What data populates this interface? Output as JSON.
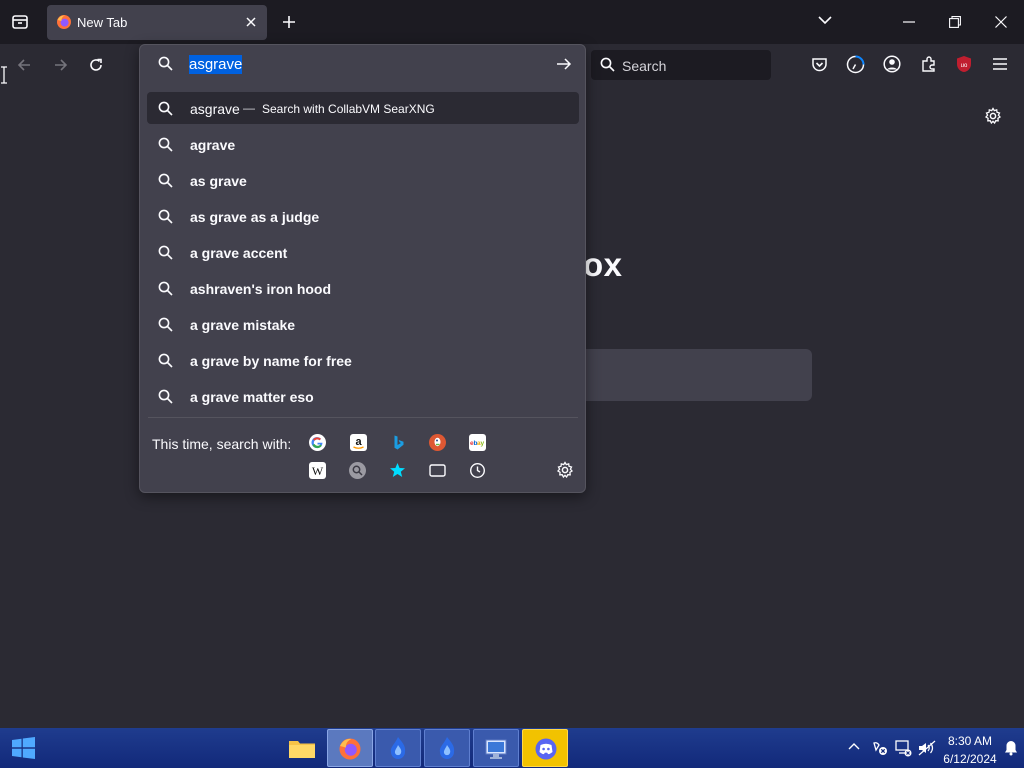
{
  "browser": {
    "tab": {
      "title": "New Tab"
    },
    "search_placeholder": "Search"
  },
  "urlbar": {
    "value": "asgrave",
    "suggestions": [
      {
        "text": "asgrave",
        "separator": "—",
        "action": "Search with CollabVM SearXNG"
      },
      {
        "text": "agrave"
      },
      {
        "text": "as grave"
      },
      {
        "text": "as grave as a judge"
      },
      {
        "text": "a grave accent"
      },
      {
        "text": "ashraven's iron hood"
      },
      {
        "text": "a grave mistake"
      },
      {
        "text": "a grave by name for free"
      },
      {
        "text": "a grave matter eso"
      }
    ],
    "one_off_label": "This time, search with:",
    "engines": [
      "google",
      "amazon",
      "bing",
      "duckduckgo",
      "ebay",
      "wikipedia",
      "search-engine",
      "bookmarks",
      "tabs",
      "history"
    ]
  },
  "newtab": {
    "brand_fragment": "ox"
  },
  "taskbar": {
    "apps": [
      "file-explorer",
      "firefox",
      "app-flame-1",
      "app-flame-2",
      "remote-desktop",
      "discord"
    ],
    "time": "8:30 AM",
    "date": "6/12/2024"
  },
  "colors": {
    "accent": "#0061e0",
    "panel": "#42414d",
    "toolbar": "#2b2a33",
    "tabstrip": "#1c1b22",
    "ublock": "#c01e2f"
  }
}
